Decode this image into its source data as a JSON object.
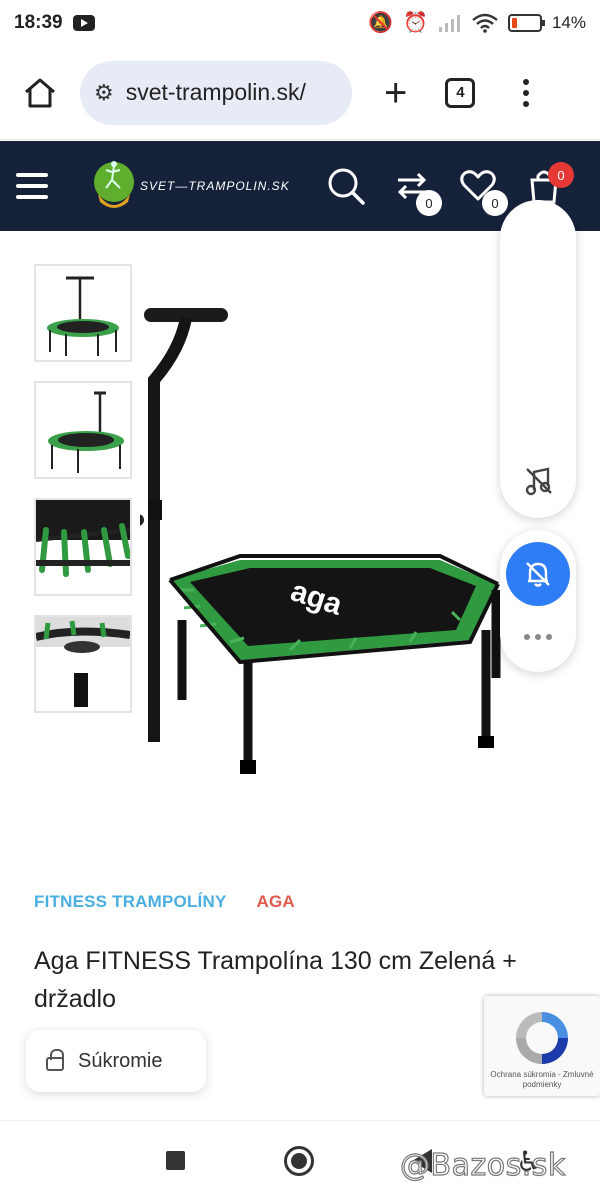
{
  "status_bar": {
    "time": "18:39",
    "battery_percent": "14%",
    "icons": [
      "youtube-icon",
      "mute-icon",
      "alarm-icon",
      "signal-icon",
      "wifi-icon",
      "battery-icon"
    ]
  },
  "browser": {
    "url": "svet-trampolin.sk/",
    "tab_count": "4",
    "icons": [
      "home-icon",
      "site-settings-icon",
      "new-tab-icon",
      "tabs-icon",
      "more-menu-icon"
    ]
  },
  "site_header": {
    "logo_text": "SVET—TRAMPOLIN.SK",
    "compare_count": "0",
    "wishlist_count": "0",
    "cart_count": "0",
    "colors": {
      "header_bg": "#15223a",
      "cart_badge": "#e53935"
    }
  },
  "gallery": {
    "thumbnails": [
      "thumbnail-1",
      "thumbnail-2",
      "thumbnail-3",
      "thumbnail-4"
    ],
    "main_image_logo": "aga"
  },
  "product": {
    "categories": [
      "FITNESS TRAMPOLÍNY",
      "AGA"
    ],
    "title": "Aga FITNESS Trampolína 130 cm Zelená + držadlo"
  },
  "privacy_chip": {
    "label": "Súkromie"
  },
  "recaptcha": {
    "text": "Ochrana súkromia - Zmluvné podmienky"
  },
  "watermark": "@Bazos.sk"
}
